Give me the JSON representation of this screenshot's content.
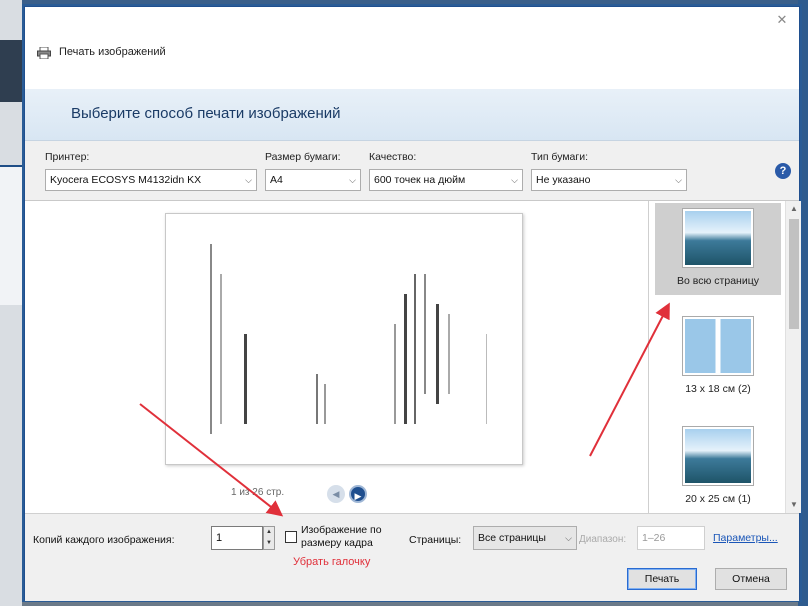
{
  "window": {
    "title": "Печать изображений",
    "close_glyph": "✕"
  },
  "header": {
    "heading": "Выберите способ печати изображений"
  },
  "controls": {
    "printer_label": "Принтер:",
    "printer_value": "Kyocera ECOSYS M4132idn KX",
    "paper_size_label": "Размер бумаги:",
    "paper_size_value": "A4",
    "quality_label": "Качество:",
    "quality_value": "600 точек на дюйм",
    "paper_type_label": "Тип бумаги:",
    "paper_type_value": "Не указано",
    "help_glyph": "?"
  },
  "preview": {
    "page_indicator": "1 из 26 стр."
  },
  "layouts": [
    {
      "label": "Во всю страницу",
      "selected": true
    },
    {
      "label": "13 x 18 см (2)",
      "selected": false
    },
    {
      "label": "20 x 25 см (1)",
      "selected": false
    }
  ],
  "bottom": {
    "copies_label": "Копий каждого изображения:",
    "copies_value": "1",
    "fit_label": "Изображение по размеру кадра",
    "fit_checked": false,
    "annotation": "Убрать галочку",
    "pages_label": "Страницы:",
    "pages_value": "Все страницы",
    "range_label": "Диапазон:",
    "range_value": "1–26",
    "params_link": "Параметры...",
    "print_button": "Печать",
    "cancel_button": "Отмена"
  },
  "colors": {
    "accent": "#1f4f8f",
    "annotation": "#e0303a",
    "link": "#1a56b8"
  },
  "icons": {
    "printer": "printer-icon",
    "help": "help-icon",
    "close": "close-icon"
  }
}
